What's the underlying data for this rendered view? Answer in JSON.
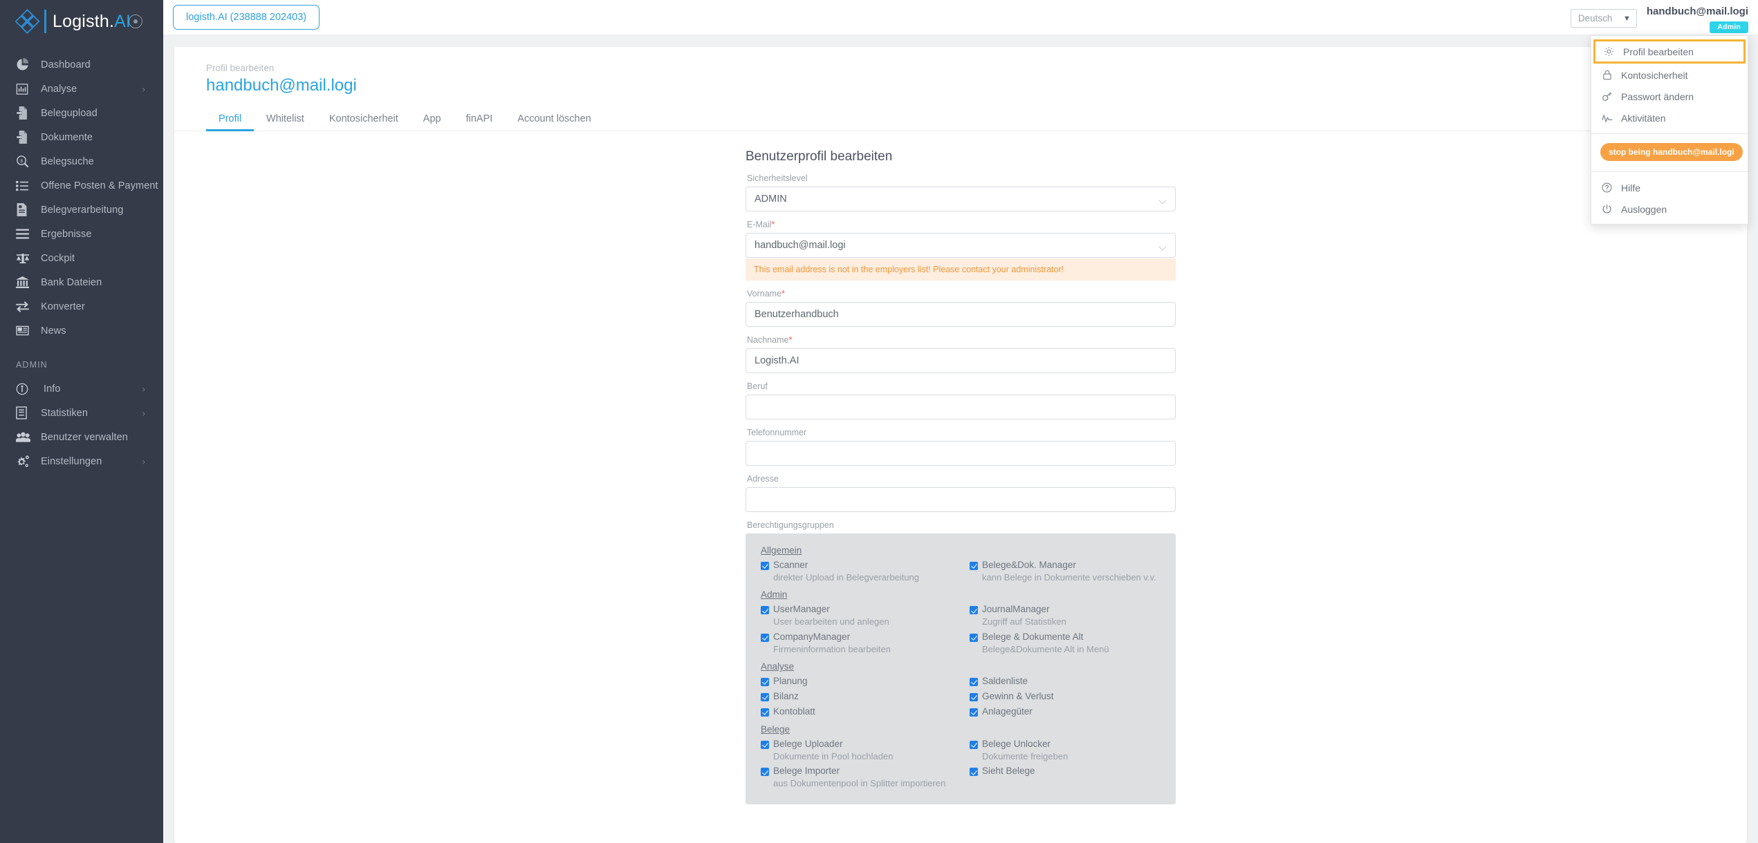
{
  "brand": {
    "name_main": "Logisth.",
    "name_accent": "AI",
    "collapse_title": "collapse-sidebar"
  },
  "sidebar": {
    "items": [
      {
        "label": "Dashboard",
        "icon": "pie-chart-icon",
        "chevron": false
      },
      {
        "label": "Analyse",
        "icon": "bar-chart-icon",
        "chevron": true
      },
      {
        "label": "Belegupload",
        "icon": "file-upload-icon",
        "chevron": false
      },
      {
        "label": "Dokumente",
        "icon": "file-upload-icon",
        "chevron": false
      },
      {
        "label": "Belegsuche",
        "icon": "search-money-icon",
        "chevron": false
      },
      {
        "label": "Offene Posten & Payment",
        "icon": "list-icon",
        "chevron": false
      },
      {
        "label": "Belegverarbeitung",
        "icon": "document-gear-icon",
        "chevron": false
      },
      {
        "label": "Ergebnisse",
        "icon": "lines-icon",
        "chevron": false
      },
      {
        "label": "Cockpit",
        "icon": "scales-icon",
        "chevron": false
      },
      {
        "label": "Bank Dateien",
        "icon": "bank-icon",
        "chevron": false
      },
      {
        "label": "Konverter",
        "icon": "exchange-icon",
        "chevron": false
      },
      {
        "label": "News",
        "icon": "news-icon",
        "chevron": false
      }
    ],
    "admin_section_label": "ADMIN",
    "admin_items": [
      {
        "label": "Info",
        "icon": "info-icon",
        "chevron": true
      },
      {
        "label": "Statistiken",
        "icon": "book-icon",
        "chevron": true
      },
      {
        "label": "Benutzer verwalten",
        "icon": "users-icon",
        "chevron": false
      },
      {
        "label": "Einstellungen",
        "icon": "gears-icon",
        "chevron": true
      }
    ]
  },
  "topbar": {
    "company_chip": "logisth.AI (238888 202403)",
    "language_value": "Deutsch",
    "user_email": "handbuch@mail.logi",
    "user_role_badge": "Admin"
  },
  "user_menu": {
    "items": [
      {
        "label": "Profil bearbeiten",
        "icon": "gear-icon",
        "highlighted": true
      },
      {
        "label": "Kontosicherheit",
        "icon": "lock-icon",
        "highlighted": false
      },
      {
        "label": "Passwort ändern",
        "icon": "key-icon",
        "highlighted": false
      },
      {
        "label": "Aktivitäten",
        "icon": "activity-icon",
        "highlighted": false
      }
    ],
    "impersonate_label": "stop being handbuch@mail.logi",
    "footer_items": [
      {
        "label": "Hilfe",
        "icon": "question-circle-icon"
      },
      {
        "label": "Ausloggen",
        "icon": "power-icon"
      }
    ]
  },
  "page": {
    "breadcrumb": "Profil bearbeiten",
    "title": "handbuch@mail.logi",
    "tabs": [
      {
        "label": "Profil",
        "active": true
      },
      {
        "label": "Whitelist",
        "active": false
      },
      {
        "label": "Kontosicherheit",
        "active": false
      },
      {
        "label": "App",
        "active": false
      },
      {
        "label": "finAPI",
        "active": false
      },
      {
        "label": "Account löschen",
        "active": false
      }
    ]
  },
  "form": {
    "title": "Benutzerprofil bearbeiten",
    "security_level_label": "Sicherheitslevel",
    "security_level_value": "ADMIN",
    "email_label": "E-Mail",
    "email_value": "handbuch@mail.logi",
    "email_alert": "This email address is not in the employers list! Please contact your administrator!",
    "first_name_label": "Vorname",
    "first_name_value": "Benutzerhandbuch",
    "last_name_label": "Nachname",
    "last_name_value": "Logisth.AI",
    "profession_label": "Beruf",
    "profession_value": "",
    "phone_label": "Telefonnummer",
    "phone_value": "",
    "address_label": "Adresse",
    "address_value": "",
    "permissions_label": "Berechtigungsgruppen",
    "required_marker": "*"
  },
  "permissions": [
    {
      "group": "Allgemein",
      "left": [
        {
          "name": "Scanner",
          "desc": "direkter Upload in Belegverarbeitung",
          "checked": true
        }
      ],
      "right": [
        {
          "name": "Belege&Dok. Manager",
          "desc": "kann Belege in Dokumente verschieben v.v.",
          "checked": true
        }
      ]
    },
    {
      "group": "Admin",
      "left": [
        {
          "name": "UserManager",
          "desc": "User bearbeiten und anlegen",
          "checked": true
        },
        {
          "name": "CompanyManager",
          "desc": "Firmeninformation bearbeiten",
          "checked": true
        }
      ],
      "right": [
        {
          "name": "JournalManager",
          "desc": "Zugriff auf Statistiken",
          "checked": true
        },
        {
          "name": "Belege & Dokumente Alt",
          "desc": "Belege&Dokumente Alt in Menü",
          "checked": true
        }
      ]
    },
    {
      "group": "Analyse",
      "left": [
        {
          "name": "Planung",
          "desc": "",
          "checked": true
        },
        {
          "name": "Bilanz",
          "desc": "",
          "checked": true
        },
        {
          "name": "Kontoblatt",
          "desc": "",
          "checked": true
        }
      ],
      "right": [
        {
          "name": "Saldenliste",
          "desc": "",
          "checked": true
        },
        {
          "name": "Gewinn & Verlust",
          "desc": "",
          "checked": true
        },
        {
          "name": "Anlagegüter",
          "desc": "",
          "checked": true
        }
      ]
    },
    {
      "group": "Belege",
      "left": [
        {
          "name": "Belege Uploader",
          "desc": "Dokumente in Pool hochladen",
          "checked": true
        },
        {
          "name": "Belege Importer",
          "desc": "aus Dokumentenpool in Splitter importieren",
          "checked": true
        }
      ],
      "right": [
        {
          "name": "Belege Unlocker",
          "desc": "Dokumente freigeben",
          "checked": true
        },
        {
          "name": "Sieht Belege",
          "desc": "",
          "checked": true
        }
      ]
    }
  ],
  "colors": {
    "sidebar_bg": "#353b48",
    "accent_blue": "#29a3e0",
    "badge_cyan": "#2fd3ea",
    "orange": "#f7a145",
    "highlight_border": "#f5b335",
    "alert_bg": "#fdeee0",
    "alert_text": "#f0973a",
    "checkbox_blue": "#1e7fe8",
    "perms_bg": "#dddfe1"
  }
}
